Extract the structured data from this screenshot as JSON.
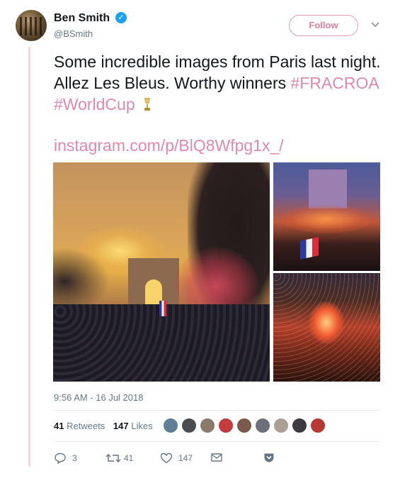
{
  "author": {
    "name": "Ben Smith",
    "handle": "@BSmith",
    "verified_mark": "✓"
  },
  "follow_button": {
    "label": "Follow"
  },
  "menu": {
    "chevron_icon": "chevron-down-icon"
  },
  "tweet": {
    "text_plain": "Some incredible images from Paris last night. Allez Les Bleus. Worthy winners",
    "hashtag_1": "#FRACROA",
    "hashtag_2": "#WorldCup",
    "emoji_icon": "trophy-icon",
    "link": "instagram.com/p/BlQ8Wfpg1x_/"
  },
  "media": {
    "images": [
      "arc-de-triomphe-sunset",
      "champs-elysees-arch-celebration",
      "champs-elysees-crowd-flares"
    ]
  },
  "timestamp": "9:56 AM - 16 Jul 2018",
  "stats": {
    "retweets_count": "41",
    "retweets_label": "Retweets",
    "likes_count": "147",
    "likes_label": "Likes"
  },
  "actions": {
    "reply_count": "3",
    "retweet_count": "41",
    "like_count": "147"
  },
  "colors": {
    "accent_link": "#e08aa5",
    "verified": "#1da1f2",
    "muted_text": "#657786",
    "rule": "#f2d8e1"
  }
}
